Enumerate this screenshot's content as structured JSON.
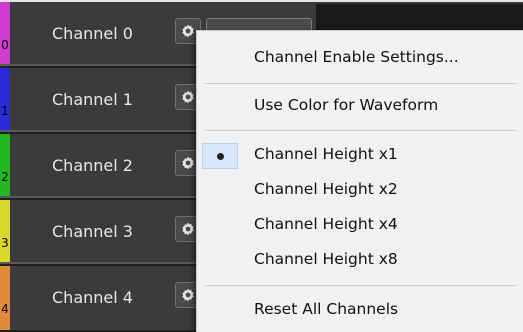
{
  "channels": [
    {
      "label": "Channel 0",
      "index": "0",
      "color": "#d23ad2"
    },
    {
      "label": "Channel 1",
      "index": "1",
      "color": "#2a2ad8"
    },
    {
      "label": "Channel 2",
      "index": "2",
      "color": "#22b822"
    },
    {
      "label": "Channel 3",
      "index": "3",
      "color": "#d8d82a"
    },
    {
      "label": "Channel 4",
      "index": "4",
      "color": "#e08a3a"
    }
  ],
  "menu": {
    "items": [
      {
        "label": "Channel Enable Settings...",
        "checked": false
      },
      {
        "label": "Use Color for Waveform",
        "checked": false
      },
      {
        "label": "Channel Height x1",
        "checked": true
      },
      {
        "label": "Channel Height x2",
        "checked": false
      },
      {
        "label": "Channel Height x4",
        "checked": false
      },
      {
        "label": "Channel Height x8",
        "checked": false
      },
      {
        "label": "Reset All Channels",
        "checked": false
      }
    ]
  },
  "icons": {
    "settings": "gear-icon",
    "selected": "radio-dot-icon"
  }
}
